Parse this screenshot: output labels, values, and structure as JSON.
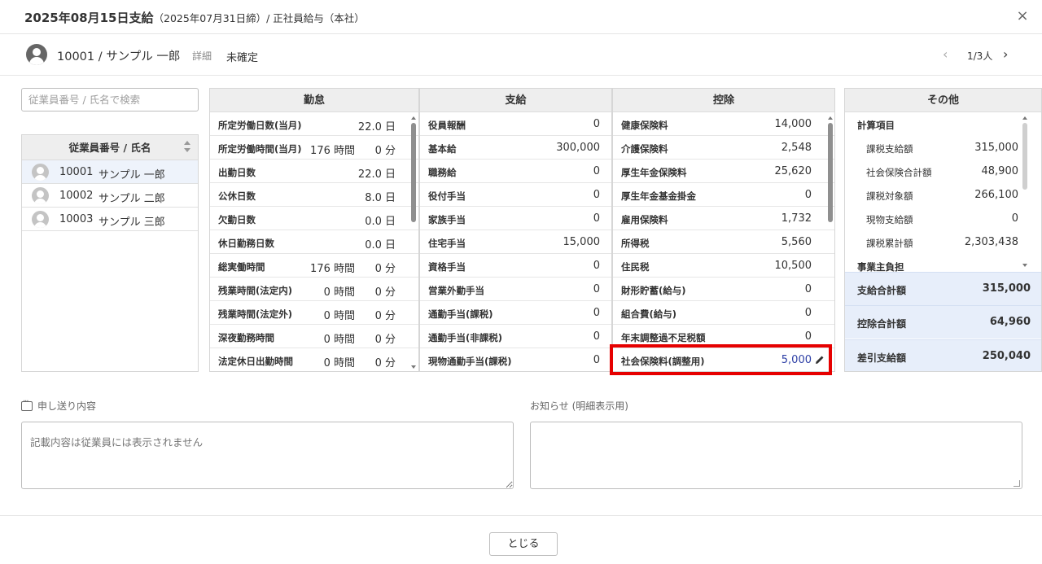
{
  "header": {
    "title": "2025年08月15日支給",
    "subtitle": "（2025年07月31日締）/ 正社員給与（本社）",
    "close_icon": "×"
  },
  "employee_bar": {
    "name": "10001 / サンプル 一郎",
    "detail_link": "詳細",
    "status": "未確定",
    "pager_prev": "‹",
    "pager_count": "1/3人",
    "pager_next": "›"
  },
  "search": {
    "placeholder": "従業員番号 / 氏名で検索"
  },
  "employee_list": {
    "header": "従業員番号 / 氏名",
    "rows": [
      {
        "id": "10001",
        "name": "サンプル 一郎"
      },
      {
        "id": "10002",
        "name": "サンプル 二郎"
      },
      {
        "id": "10003",
        "name": "サンプル 三郎"
      }
    ]
  },
  "attendance": {
    "header": "勤怠",
    "rows": [
      {
        "label": "所定労働日数(当月)",
        "value": "22.0 日"
      },
      {
        "label": "所定労働時間(当月)",
        "value": "176 時間",
        "minutes": "0 分"
      },
      {
        "label": "出勤日数",
        "value": "22.0 日"
      },
      {
        "label": "公休日数",
        "value": "8.0 日"
      },
      {
        "label": "欠勤日数",
        "value": "0.0 日"
      },
      {
        "label": "休日勤務日数",
        "value": "0.0 日"
      },
      {
        "label": "総実働時間",
        "value": "176 時間",
        "minutes": "0 分"
      },
      {
        "label": "残業時間(法定内)",
        "value": "0 時間",
        "minutes": "0 分"
      },
      {
        "label": "残業時間(法定外)",
        "value": "0 時間",
        "minutes": "0 分"
      },
      {
        "label": "深夜勤務時間",
        "value": "0 時間",
        "minutes": "0 分"
      },
      {
        "label": "法定休日出勤時間",
        "value": "0 時間",
        "minutes": "0 分"
      }
    ]
  },
  "payment": {
    "header": "支給",
    "rows": [
      {
        "label": "役員報酬",
        "value": "0"
      },
      {
        "label": "基本給",
        "value": "300,000"
      },
      {
        "label": "職務給",
        "value": "0"
      },
      {
        "label": "役付手当",
        "value": "0"
      },
      {
        "label": "家族手当",
        "value": "0"
      },
      {
        "label": "住宅手当",
        "value": "15,000"
      },
      {
        "label": "資格手当",
        "value": "0"
      },
      {
        "label": "営業外勤手当",
        "value": "0"
      },
      {
        "label": "通勤手当(課税)",
        "value": "0"
      },
      {
        "label": "通勤手当(非課税)",
        "value": "0"
      },
      {
        "label": "現物通勤手当(課税)",
        "value": "0"
      }
    ]
  },
  "deduction": {
    "header": "控除",
    "rows": [
      {
        "label": "健康保険料",
        "value": "14,000"
      },
      {
        "label": "介護保険料",
        "value": "2,548"
      },
      {
        "label": "厚生年金保険料",
        "value": "25,620"
      },
      {
        "label": "厚生年金基金掛金",
        "value": "0"
      },
      {
        "label": "雇用保険料",
        "value": "1,732"
      },
      {
        "label": "所得税",
        "value": "5,560"
      },
      {
        "label": "住民税",
        "value": "10,500"
      },
      {
        "label": "財形貯蓄(給与)",
        "value": "0"
      },
      {
        "label": "組合費(給与)",
        "value": "0"
      },
      {
        "label": "年末調整過不足税額",
        "value": "0"
      },
      {
        "label": "社会保険料(調整用)",
        "value": "5,000",
        "edited": true,
        "icon": "pencil-icon"
      }
    ]
  },
  "other": {
    "header": "その他",
    "section1": "計算項目",
    "items": [
      {
        "label": "課税支給額",
        "value": "315,000"
      },
      {
        "label": "社会保険合計額",
        "value": "48,900"
      },
      {
        "label": "課税対象額",
        "value": "266,100"
      },
      {
        "label": "現物支給額",
        "value": "0"
      },
      {
        "label": "課税累計額",
        "value": "2,303,438"
      }
    ],
    "section2": "事業主負担",
    "totals": [
      {
        "label": "支給合計額",
        "value": "315,000"
      },
      {
        "label": "控除合計額",
        "value": "64,960"
      },
      {
        "label": "差引支給額",
        "value": "250,040"
      }
    ]
  },
  "memo": {
    "label": "申し送り内容",
    "placeholder": "記載内容は従業員には表示されません"
  },
  "notice": {
    "label": "お知らせ (明細表示用)"
  },
  "footer": {
    "close_label": "とじる"
  },
  "colors": {
    "highlight": "#e60000",
    "edited_value": "#2d3fa6",
    "total_bg": "#e7eefa",
    "selected_row": "#eef3fb"
  }
}
